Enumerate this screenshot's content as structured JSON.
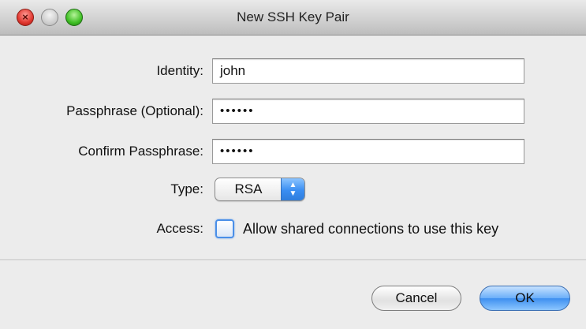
{
  "window": {
    "title": "New SSH Key Pair"
  },
  "form": {
    "identity_label": "Identity:",
    "identity_value": "john",
    "passphrase_label": "Passphrase (Optional):",
    "passphrase_value": "••••••",
    "confirm_label": "Confirm Passphrase:",
    "confirm_value": "••••••",
    "type_label": "Type:",
    "type_value": "RSA",
    "access_label": "Access:",
    "access_checkbox_label": "Allow shared connections to use this key",
    "access_checked": false
  },
  "buttons": {
    "cancel": "Cancel",
    "ok": "OK"
  },
  "colors": {
    "accent": "#3d8ff0",
    "close": "#e0372f",
    "zoom": "#3fbf24"
  }
}
